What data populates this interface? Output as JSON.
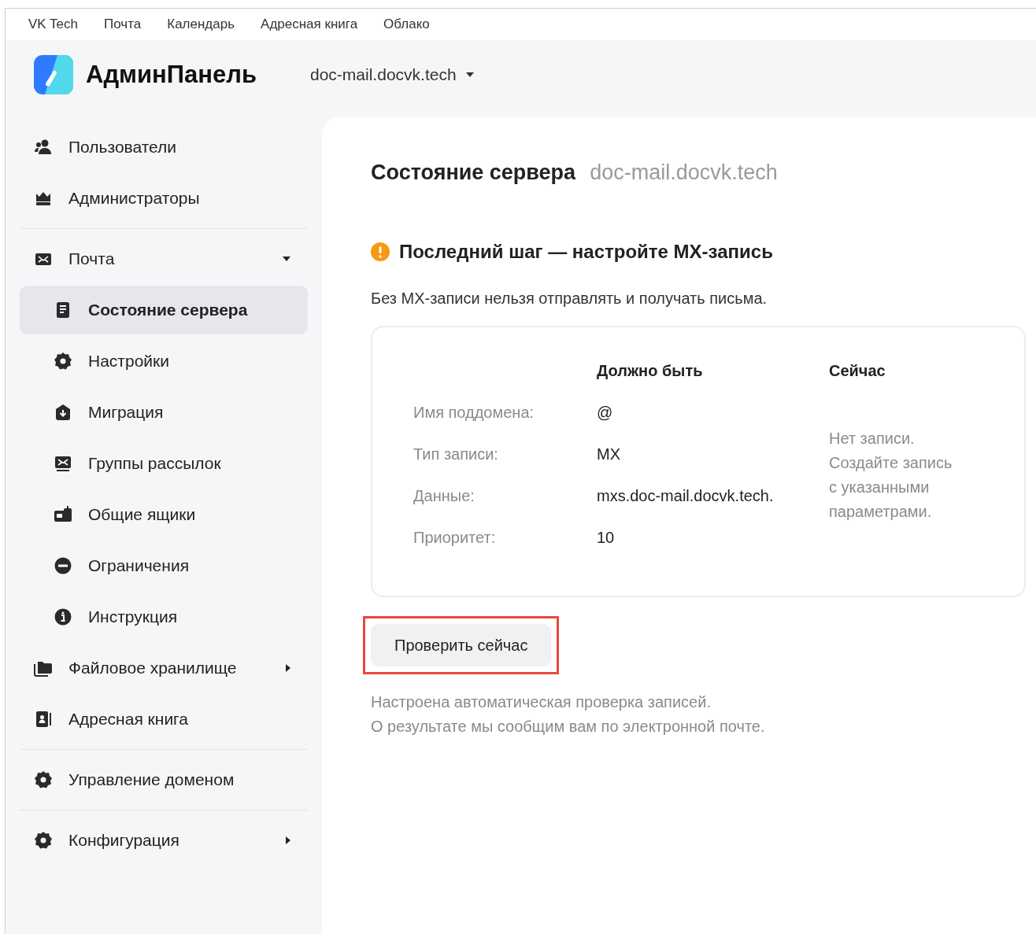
{
  "top_nav": [
    "VK Tech",
    "Почта",
    "Календарь",
    "Адресная книга",
    "Облако"
  ],
  "header": {
    "app_title": "АдминПанель",
    "domain": "doc-mail.docvk.tech"
  },
  "sidebar": {
    "groups": [
      {
        "items": [
          {
            "label": "Пользователи",
            "selected": false
          },
          {
            "label": "Администраторы",
            "selected": false
          }
        ]
      },
      {
        "items": [
          {
            "label": "Почта",
            "selected": false,
            "expanded": true,
            "children": [
              {
                "label": "Состояние сервера",
                "selected": true
              },
              {
                "label": "Настройки",
                "selected": false
              },
              {
                "label": "Миграция",
                "selected": false
              },
              {
                "label": "Группы рассылок",
                "selected": false
              },
              {
                "label": "Общие ящики",
                "selected": false
              },
              {
                "label": "Ограничения",
                "selected": false
              },
              {
                "label": "Инструкция",
                "selected": false
              }
            ]
          },
          {
            "label": "Файловое хранилище",
            "selected": false,
            "expanded": false
          },
          {
            "label": "Адресная книга",
            "selected": false
          }
        ]
      },
      {
        "items": [
          {
            "label": "Управление доменом",
            "selected": false
          }
        ]
      },
      {
        "items": [
          {
            "label": "Конфигурация",
            "selected": false,
            "expanded": false
          }
        ]
      }
    ]
  },
  "main": {
    "title": "Состояние сервера",
    "title_domain": "doc-mail.docvk.tech",
    "warning_heading": "Последний шаг — настройте MX-запись",
    "warning_text": "Без MX-записи нельзя отправлять и получать письма.",
    "table": {
      "columns": [
        "Должно быть",
        "Сейчас"
      ],
      "rows": [
        {
          "label": "Имя поддомена:",
          "value": "@"
        },
        {
          "label": "Тип записи:",
          "value": "MX"
        },
        {
          "label": "Данные:",
          "value": "mxs.doc-mail.docvk.tech."
        },
        {
          "label": "Приоритет:",
          "value": "10"
        }
      ],
      "current_lines": [
        "Нет записи.",
        "Создайте запись",
        "с указанными",
        "параметрами."
      ]
    },
    "check_button": {
      "label": "Проверить сейчас",
      "highlighted": true
    },
    "footnote_lines": [
      "Настроена автоматическая проверка записей.",
      "О результате мы сообщим вам по электронной почте."
    ]
  }
}
